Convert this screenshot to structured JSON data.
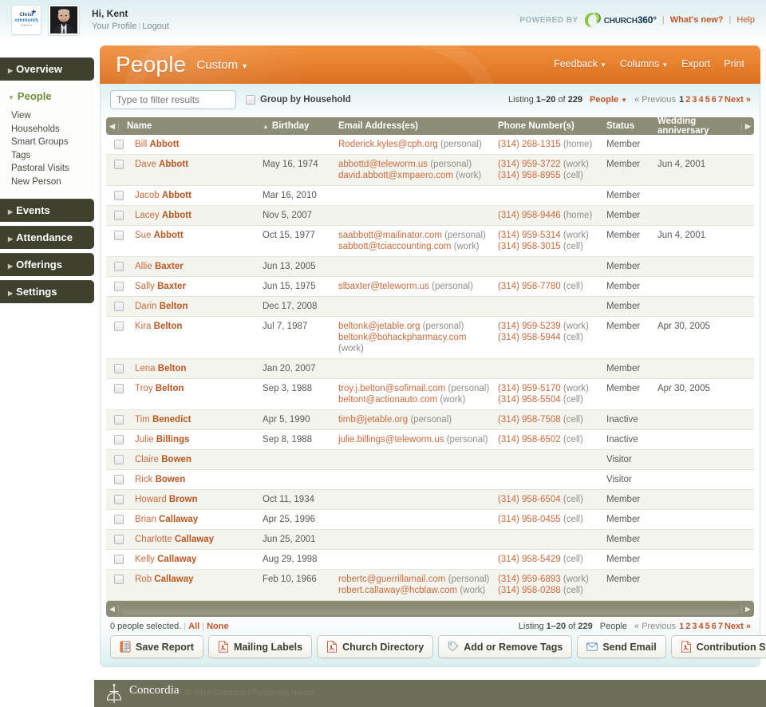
{
  "topbar": {
    "logo_alt": "Christ Community Church",
    "logo_line1": "Christ",
    "logo_line2": "Community",
    "logo_line3": "CHURCH",
    "greeting": "Hi, Kent",
    "profile_link": "Your Profile",
    "separator": "|",
    "logout_link": "Logout",
    "powered_by": "POWERED BY",
    "brand_church": "CHURCH",
    "brand_360": "360",
    "brand_tm": "°",
    "whats_new": "What's new?",
    "help": "Help"
  },
  "sidebar": {
    "items": [
      {
        "label": "Overview",
        "state": "collapsed",
        "children": []
      },
      {
        "label": "People",
        "state": "expanded",
        "children": [
          "View",
          "Households",
          "Smart Groups",
          "Tags",
          "Pastoral Visits",
          "New Person"
        ]
      },
      {
        "label": "Events",
        "state": "collapsed",
        "children": []
      },
      {
        "label": "Attendance",
        "state": "collapsed",
        "children": []
      },
      {
        "label": "Offerings",
        "state": "collapsed",
        "children": []
      },
      {
        "label": "Settings",
        "state": "collapsed",
        "children": []
      }
    ]
  },
  "page_header": {
    "title": "People",
    "view_name": "Custom",
    "menu": [
      {
        "label": "Feedback",
        "has_caret": true
      },
      {
        "label": "Columns",
        "has_caret": true
      },
      {
        "label": "Export",
        "has_caret": false
      },
      {
        "label": "Print",
        "has_caret": false
      }
    ]
  },
  "toolbar": {
    "filter_placeholder": "Type to filter results",
    "filter_value": "",
    "group_by_household_label": "Group by Household",
    "group_by_household_checked": false,
    "listing_prefix": "Listing",
    "listing_range": "1–20",
    "listing_of": "of",
    "listing_total": "229",
    "record_type": "People",
    "pager": {
      "previous": "« Previous",
      "pages": [
        "1",
        "2",
        "3",
        "4",
        "5",
        "6",
        "7"
      ],
      "current_page": "1",
      "next": "Next »"
    }
  },
  "table": {
    "columns": [
      {
        "label": "Name",
        "sorted": true,
        "sort_dir": "asc"
      },
      {
        "label": "Birthday",
        "sorted": false
      },
      {
        "label": "Email Address(es)",
        "sorted": false
      },
      {
        "label": "Phone Number(s)",
        "sorted": false
      },
      {
        "label": "Status",
        "sorted": false
      },
      {
        "label": "Wedding anniversary",
        "sorted": false
      }
    ],
    "scroll_left_icon": "◀",
    "scroll_right_icon": "▶",
    "rows": [
      {
        "first": "Bill",
        "last": "Abbott",
        "birthday": "",
        "emails": [
          {
            "addr": "Roderick.kyles@cph.org",
            "kind": "(personal)"
          }
        ],
        "phones": [
          {
            "num": "(314) 268-1315",
            "kind": "(home)"
          }
        ],
        "status": "Member",
        "anniversary": ""
      },
      {
        "first": "Dave",
        "last": "Abbott",
        "birthday": "May 16, 1974",
        "emails": [
          {
            "addr": "abbottd@teleworm.us",
            "kind": "(personal)"
          },
          {
            "addr": "david.abbott@xmpaero.com",
            "kind": "(work)"
          }
        ],
        "phones": [
          {
            "num": "(314) 959-3722",
            "kind": "(work)"
          },
          {
            "num": "(314) 958-8955",
            "kind": "(cell)"
          }
        ],
        "status": "Member",
        "anniversary": "Jun 4, 2001"
      },
      {
        "first": "Jacob",
        "last": "Abbott",
        "birthday": "Mar 16, 2010",
        "emails": [],
        "phones": [],
        "status": "Member",
        "anniversary": ""
      },
      {
        "first": "Lacey",
        "last": "Abbott",
        "birthday": "Nov 5, 2007",
        "emails": [],
        "phones": [
          {
            "num": "(314) 958-9446",
            "kind": "(home)"
          }
        ],
        "status": "Member",
        "anniversary": ""
      },
      {
        "first": "Sue",
        "last": "Abbott",
        "birthday": "Oct 15, 1977",
        "emails": [
          {
            "addr": "saabbott@mailinator.com",
            "kind": "(personal)"
          },
          {
            "addr": "sabbott@tciaccounting.com",
            "kind": "(work)"
          }
        ],
        "phones": [
          {
            "num": "(314) 959-5314",
            "kind": "(work)"
          },
          {
            "num": "(314) 958-3015",
            "kind": "(cell)"
          }
        ],
        "status": "Member",
        "anniversary": "Jun 4, 2001"
      },
      {
        "first": "Allie",
        "last": "Baxter",
        "birthday": "Jun 13, 2005",
        "emails": [],
        "phones": [],
        "status": "Member",
        "anniversary": ""
      },
      {
        "first": "Sally",
        "last": "Baxter",
        "birthday": "Jun 15, 1975",
        "emails": [
          {
            "addr": "slbaxter@teleworm.us",
            "kind": "(personal)"
          }
        ],
        "phones": [
          {
            "num": "(314) 958-7780",
            "kind": "(cell)"
          }
        ],
        "status": "Member",
        "anniversary": ""
      },
      {
        "first": "Darin",
        "last": "Belton",
        "birthday": "Dec 17, 2008",
        "emails": [],
        "phones": [],
        "status": "Member",
        "anniversary": ""
      },
      {
        "first": "Kira",
        "last": "Belton",
        "birthday": "Jul 7, 1987",
        "emails": [
          {
            "addr": "beltonk@jetable.org",
            "kind": "(personal)"
          },
          {
            "addr": "beltonk@bohackpharmacy.com",
            "kind": "(work)"
          }
        ],
        "phones": [
          {
            "num": "(314) 959-5239",
            "kind": "(work)"
          },
          {
            "num": "(314) 958-5944",
            "kind": "(cell)"
          }
        ],
        "status": "Member",
        "anniversary": "Apr 30, 2005"
      },
      {
        "first": "Lena",
        "last": "Belton",
        "birthday": "Jan 20, 2007",
        "emails": [],
        "phones": [],
        "status": "Member",
        "anniversary": ""
      },
      {
        "first": "Troy",
        "last": "Belton",
        "birthday": "Sep 3, 1988",
        "emails": [
          {
            "addr": "troy.j.belton@sofimail.com",
            "kind": "(personal)"
          },
          {
            "addr": "beltont@actionauto.com",
            "kind": "(work)"
          }
        ],
        "phones": [
          {
            "num": "(314) 959-5170",
            "kind": "(work)"
          },
          {
            "num": "(314) 958-5504",
            "kind": "(cell)"
          }
        ],
        "status": "Member",
        "anniversary": "Apr 30, 2005"
      },
      {
        "first": "Tim",
        "last": "Benedict",
        "birthday": "Apr 5, 1990",
        "emails": [
          {
            "addr": "timb@jetable.org",
            "kind": "(personal)"
          }
        ],
        "phones": [
          {
            "num": "(314) 958-7508",
            "kind": "(cell)"
          }
        ],
        "status": "Inactive",
        "anniversary": ""
      },
      {
        "first": "Julie",
        "last": "Billings",
        "birthday": "Sep 8, 1988",
        "emails": [
          {
            "addr": "julie.billings@teleworm.us",
            "kind": "(personal)"
          }
        ],
        "phones": [
          {
            "num": "(314) 958-6502",
            "kind": "(cell)"
          }
        ],
        "status": "Inactive",
        "anniversary": ""
      },
      {
        "first": "Claire",
        "last": "Bowen",
        "birthday": "",
        "emails": [],
        "phones": [],
        "status": "Visitor",
        "anniversary": ""
      },
      {
        "first": "Rick",
        "last": "Bowen",
        "birthday": "",
        "emails": [],
        "phones": [],
        "status": "Visitor",
        "anniversary": ""
      },
      {
        "first": "Howard",
        "last": "Brown",
        "birthday": "Oct 11, 1934",
        "emails": [],
        "phones": [
          {
            "num": "(314) 958-6504",
            "kind": "(cell)"
          }
        ],
        "status": "Member",
        "anniversary": ""
      },
      {
        "first": "Brian",
        "last": "Callaway",
        "birthday": "Apr 25, 1996",
        "emails": [],
        "phones": [
          {
            "num": "(314) 958-0455",
            "kind": "(cell)"
          }
        ],
        "status": "Member",
        "anniversary": ""
      },
      {
        "first": "Charlotte",
        "last": "Callaway",
        "birthday": "Jun 25, 2001",
        "emails": [],
        "phones": [],
        "status": "Member",
        "anniversary": ""
      },
      {
        "first": "Kelly",
        "last": "Callaway",
        "birthday": "Aug 29, 1998",
        "emails": [],
        "phones": [
          {
            "num": "(314) 958-5429",
            "kind": "(cell)"
          }
        ],
        "status": "Member",
        "anniversary": ""
      },
      {
        "first": "Rob",
        "last": "Callaway",
        "birthday": "Feb 10, 1966",
        "emails": [
          {
            "addr": "robertc@guerrillamail.com",
            "kind": "(personal)"
          },
          {
            "addr": "robert.callaway@hcblaw.com",
            "kind": "(work)"
          }
        ],
        "phones": [
          {
            "num": "(314) 959-6893",
            "kind": "(work)"
          },
          {
            "num": "(314) 958-0288",
            "kind": "(cell)"
          }
        ],
        "status": "Member",
        "anniversary": ""
      }
    ]
  },
  "actions": {
    "selected_text": "0 people selected.",
    "select_all": "All",
    "select_none": "None",
    "listing_prefix": "Listing",
    "listing_range": "1–20",
    "listing_of": "of",
    "listing_total": "229",
    "record_type": "People",
    "pager": {
      "previous": "« Previous",
      "pages": [
        "1",
        "2",
        "3",
        "4",
        "5",
        "6",
        "7"
      ],
      "current_page": "1",
      "next": "Next »"
    },
    "buttons": [
      {
        "label": "Save Report",
        "icon": "report-icon"
      },
      {
        "label": "Mailing Labels",
        "icon": "pdf-icon"
      },
      {
        "label": "Church Directory",
        "icon": "pdf-icon"
      },
      {
        "label": "Add or Remove Tags",
        "icon": "tag-icon"
      },
      {
        "label": "Send Email",
        "icon": "envelope-icon"
      },
      {
        "label": "Contribution Statements",
        "icon": "pdf-icon"
      }
    ]
  },
  "footer": {
    "brand": "Concordia",
    "copyright": "© 2014 Concordia Publishing House"
  },
  "colors": {
    "orange": "#e8822f",
    "link": "#c0552c",
    "sidebar_dark": "#3f412e",
    "table_header": "#8d8d77",
    "panel_border": "#cfe1e3",
    "footer_bg": "#6d6f58"
  }
}
